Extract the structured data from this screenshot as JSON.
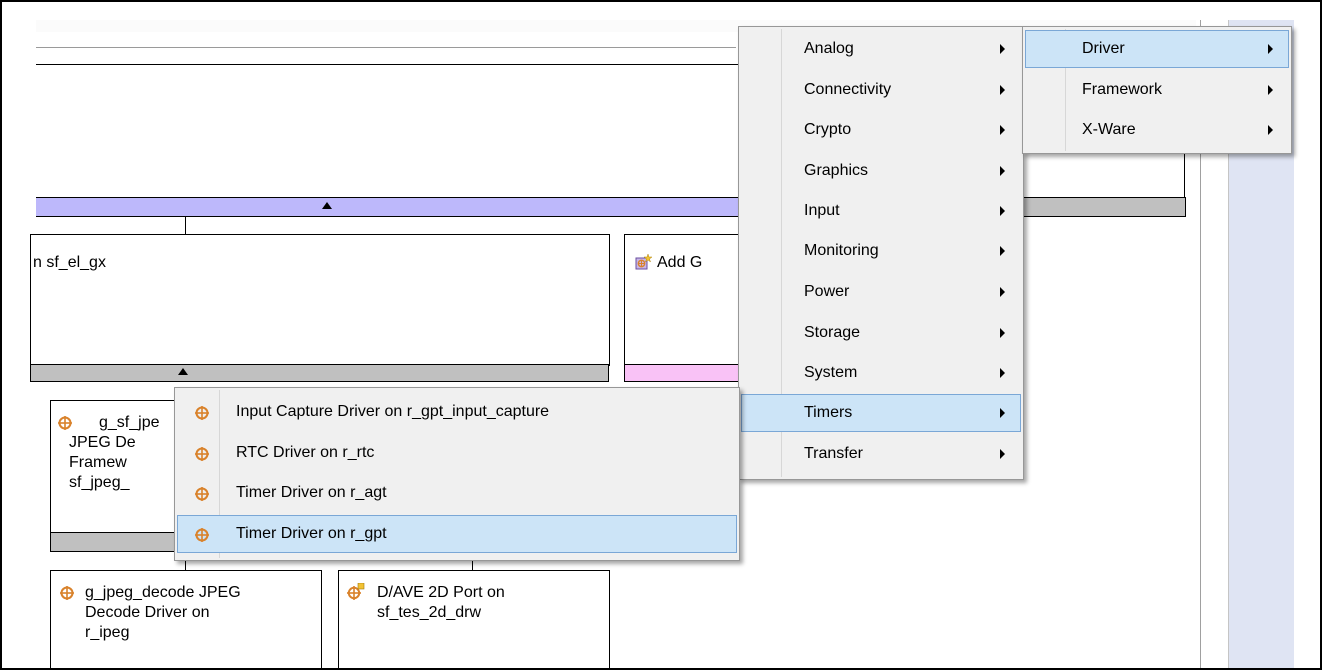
{
  "diagram": {
    "module_sf_el_gx": {
      "label": "n sf_el_gx"
    },
    "add_module": {
      "label": "Add G"
    },
    "module_jpeg_framework": {
      "lines": [
        "g_sf_jpe",
        "JPEG De",
        "Framew",
        "sf_jpeg_"
      ]
    },
    "module_jpeg_decode": {
      "lines": [
        "g_jpeg_decode JPEG",
        "Decode Driver on",
        "r_ipeg"
      ]
    },
    "module_dave2d": {
      "lines": [
        "D/AVE 2D Port on",
        "sf_tes_2d_drw"
      ]
    }
  },
  "category_menu": {
    "items": [
      {
        "label": "Analog"
      },
      {
        "label": "Connectivity"
      },
      {
        "label": "Crypto"
      },
      {
        "label": "Graphics"
      },
      {
        "label": "Input"
      },
      {
        "label": "Monitoring"
      },
      {
        "label": "Power"
      },
      {
        "label": "Storage"
      },
      {
        "label": "System"
      },
      {
        "label": "Timers"
      },
      {
        "label": "Transfer"
      }
    ]
  },
  "type_menu": {
    "items": [
      {
        "label": "Driver"
      },
      {
        "label": "Framework"
      },
      {
        "label": "X-Ware"
      }
    ]
  },
  "timers_menu": {
    "items": [
      {
        "label": "Input Capture Driver on r_gpt_input_capture"
      },
      {
        "label": "RTC Driver on r_rtc"
      },
      {
        "label": "Timer Driver on r_agt"
      },
      {
        "label": "Timer Driver on r_gpt"
      }
    ]
  },
  "colors": {
    "stack_bar_purple": "#bdb8fb",
    "stack_bar_gray": "#c0c0c0",
    "stack_bar_pink": "#f9c2f6",
    "menu_highlight": "#cce4f7",
    "right_panel": "#dfe4f3",
    "icon_orange": "#d9822b"
  }
}
